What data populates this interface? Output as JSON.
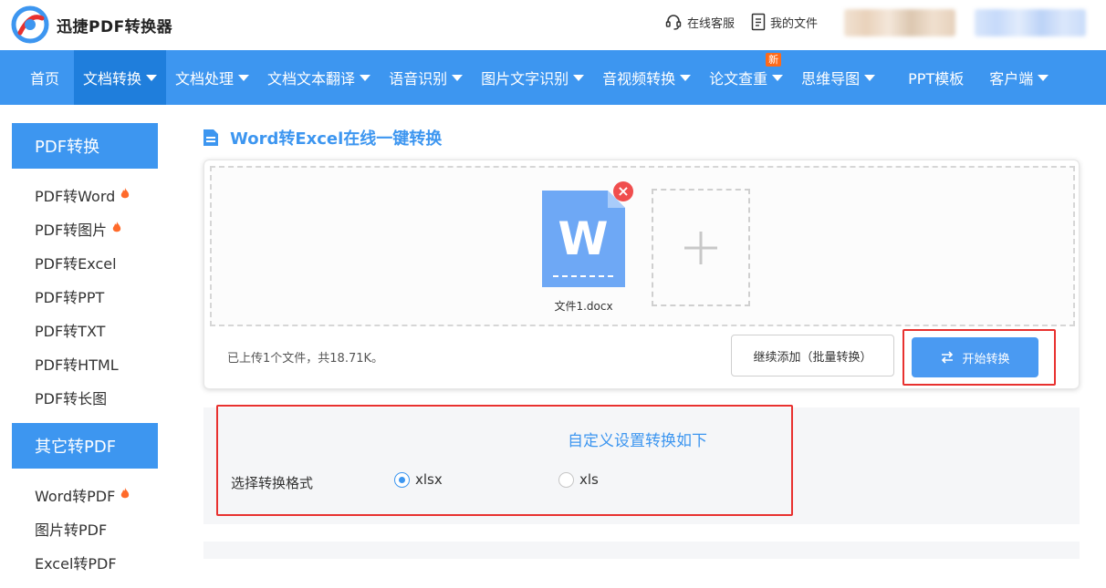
{
  "app": {
    "title": "迅捷PDF转换器"
  },
  "header": {
    "service_label": "在线客服",
    "files_label": "我的文件"
  },
  "nav": {
    "items": [
      {
        "label": "首页",
        "has_dropdown": false
      },
      {
        "label": "文档转换",
        "has_dropdown": true,
        "active": true
      },
      {
        "label": "文档处理",
        "has_dropdown": true
      },
      {
        "label": "文档文本翻译",
        "has_dropdown": true
      },
      {
        "label": "语音识别",
        "has_dropdown": true
      },
      {
        "label": "图片文字识别",
        "has_dropdown": true
      },
      {
        "label": "音视频转换",
        "has_dropdown": true
      },
      {
        "label": "论文查重",
        "has_dropdown": true,
        "badge": "新"
      },
      {
        "label": "思维导图",
        "has_dropdown": true
      },
      {
        "label": "PPT模板",
        "has_dropdown": false
      },
      {
        "label": "客户端",
        "has_dropdown": true
      }
    ]
  },
  "sidebar": {
    "group1_title": "PDF转换",
    "group1_items": [
      "PDF转Word",
      "PDF转图片",
      "PDF转Excel",
      "PDF转PPT",
      "PDF转TXT",
      "PDF转HTML",
      "PDF转长图"
    ],
    "group2_title": "其它转PDF",
    "group2_items": [
      "Word转PDF",
      "图片转PDF",
      "Excel转PDF"
    ]
  },
  "main": {
    "title": "Word转Excel在线一键转换",
    "file": {
      "name": "文件1.docx",
      "icon_letter": "W"
    },
    "upload_info": "已上传1个文件，共18.71K。",
    "add_more_label": "继续添加（批量转换）",
    "start_label": "开始转换"
  },
  "settings": {
    "title": "自定义设置转换如下",
    "format_label": "选择转换格式",
    "options": [
      {
        "label": "xlsx",
        "checked": true
      },
      {
        "label": "xls",
        "checked": false
      }
    ]
  },
  "colors": {
    "brand": "#3d96f0",
    "highlight": "#e8312f",
    "danger": "#f04e4e"
  }
}
